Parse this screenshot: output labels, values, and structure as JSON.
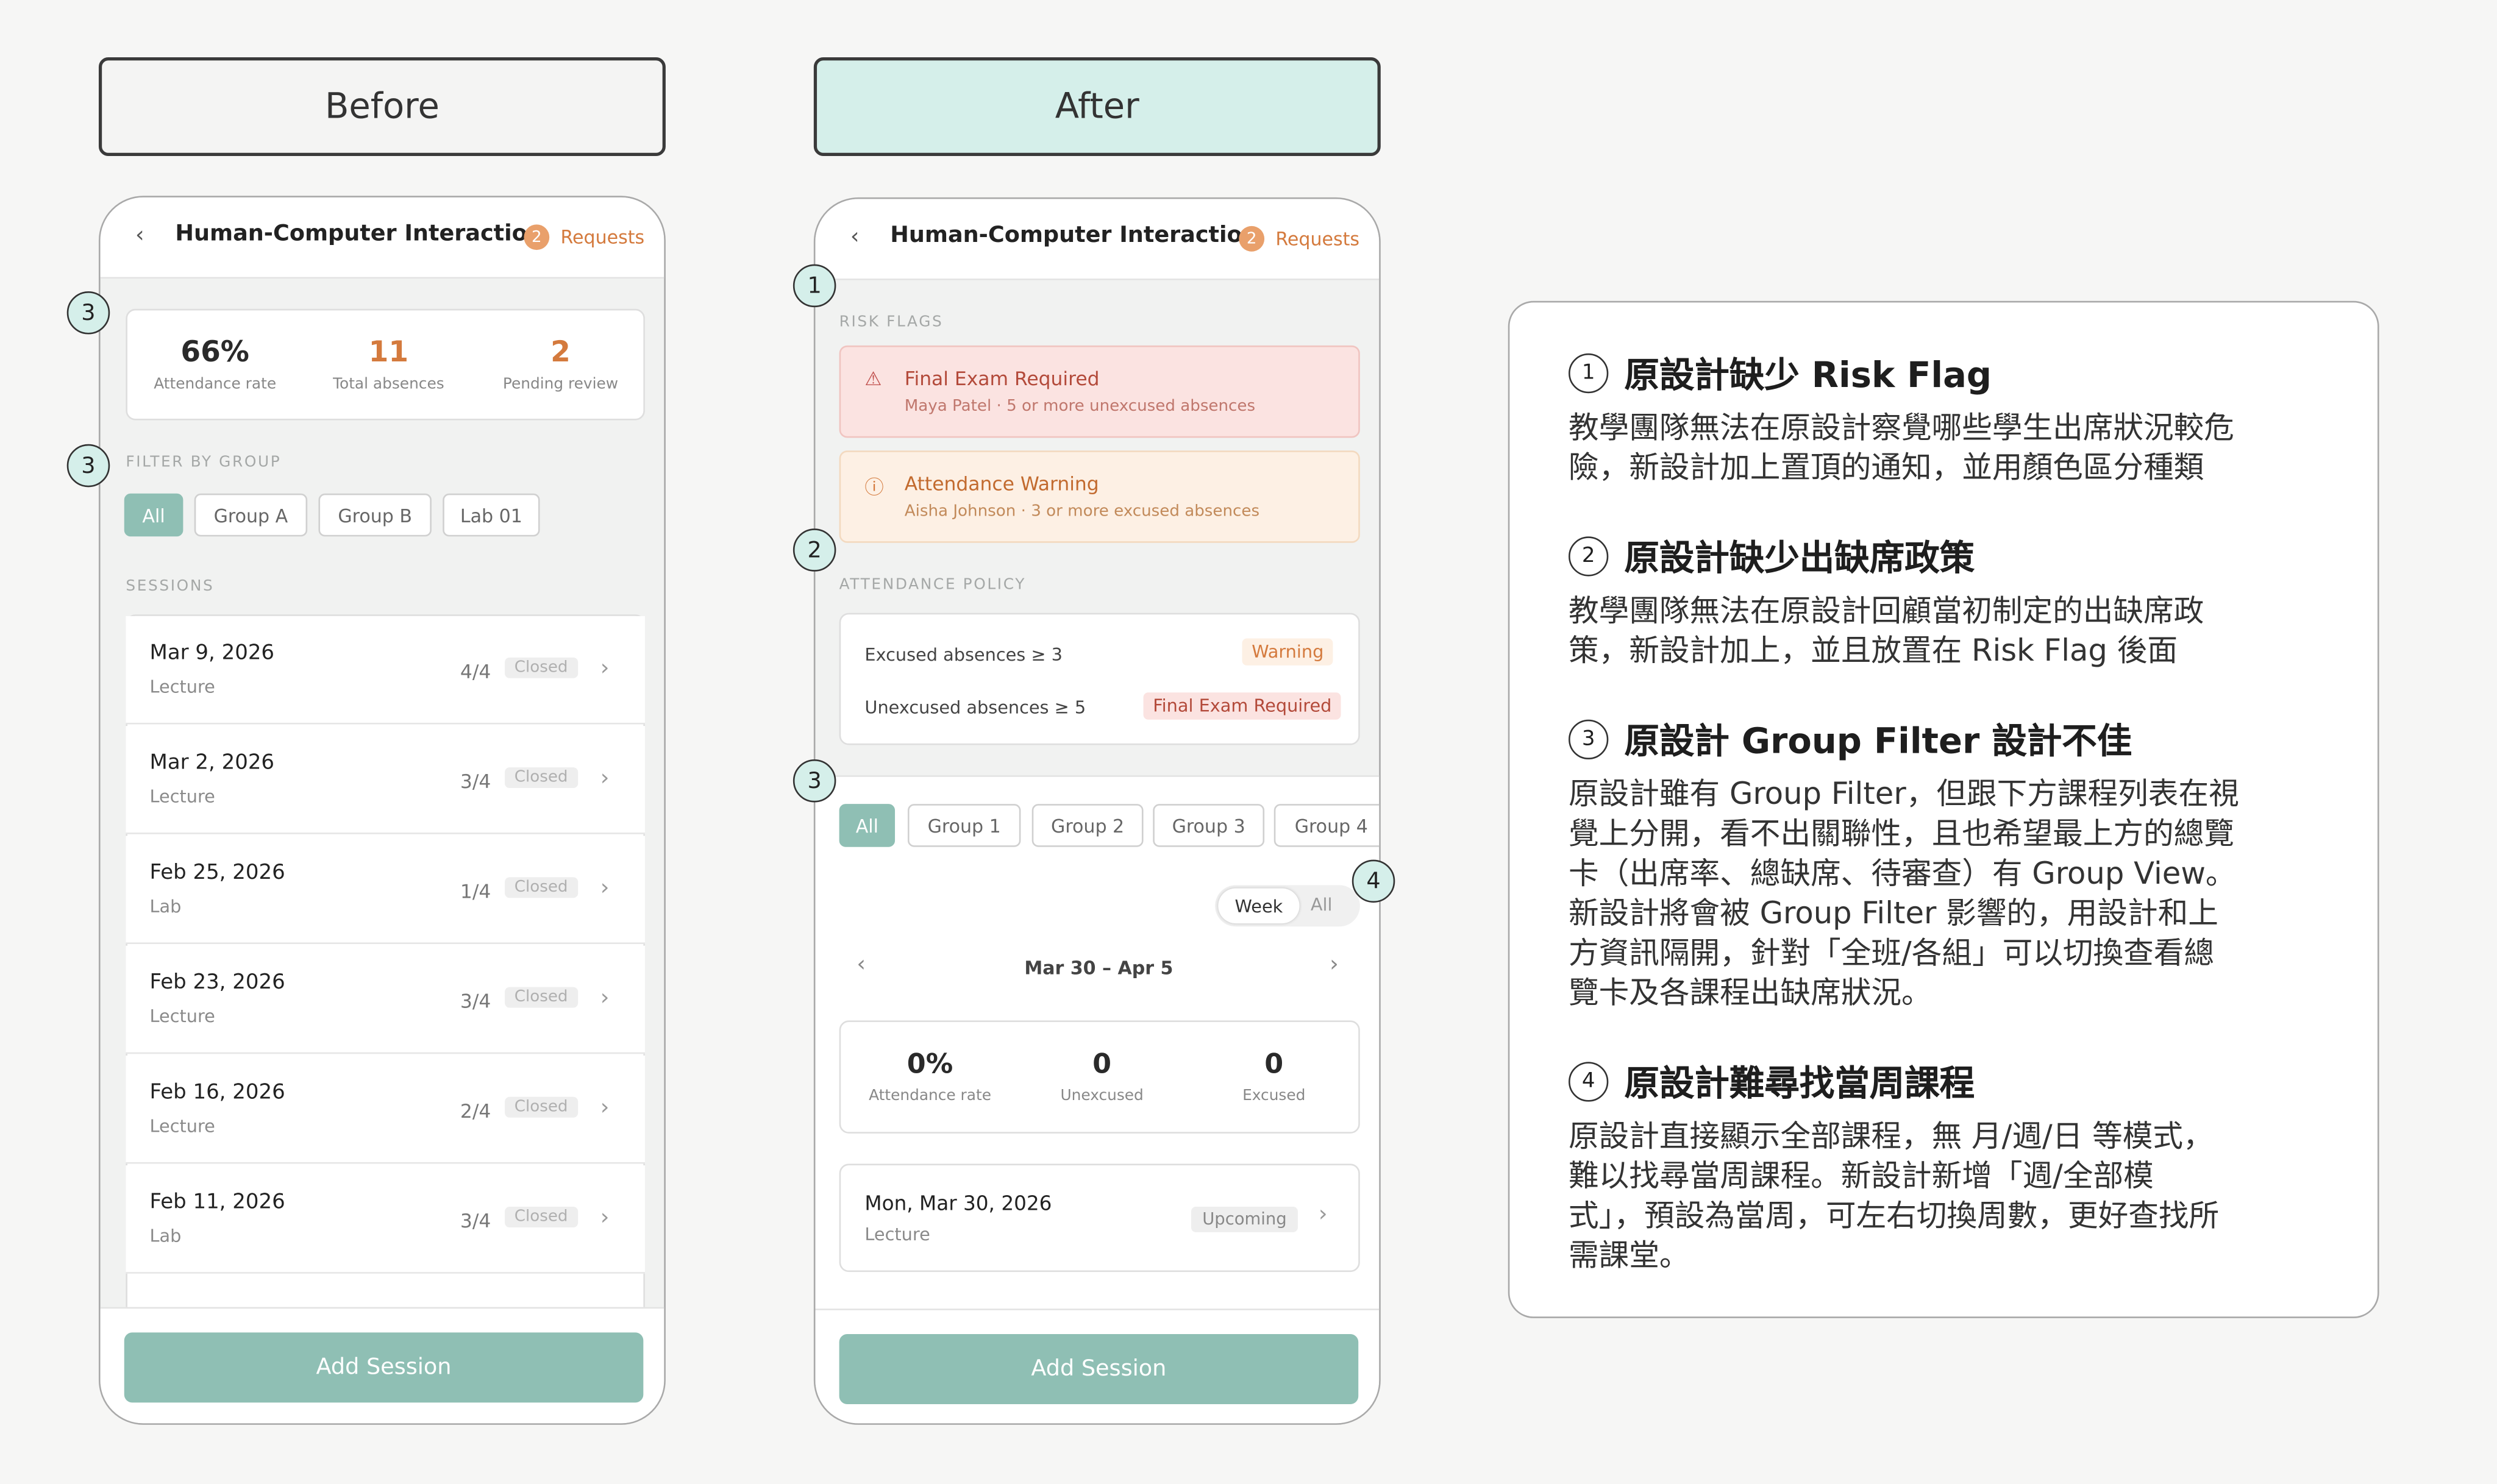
{
  "headers": {
    "before": "Before",
    "after": "After"
  },
  "app": {
    "title": "Human-Computer Interaction",
    "requests_count": "2",
    "requests_label": "Requests",
    "back_icon": "‹"
  },
  "before": {
    "stats": [
      {
        "value": "66%",
        "label": "Attendance rate"
      },
      {
        "value": "11",
        "label": "Total absences"
      },
      {
        "value": "2",
        "label": "Pending review"
      }
    ],
    "filter_label": "FILTER BY GROUP",
    "filters": [
      "All",
      "Group A",
      "Group B",
      "Lab 01"
    ],
    "sessions_label": "SESSIONS",
    "sessions": [
      {
        "date": "Mar 9, 2026",
        "type": "Lecture",
        "count": "4/4",
        "status": "Closed"
      },
      {
        "date": "Mar 2, 2026",
        "type": "Lecture",
        "count": "3/4",
        "status": "Closed"
      },
      {
        "date": "Feb 25, 2026",
        "type": "Lab",
        "count": "1/4",
        "status": "Closed"
      },
      {
        "date": "Feb 23, 2026",
        "type": "Lecture",
        "count": "3/4",
        "status": "Closed"
      },
      {
        "date": "Feb 16, 2026",
        "type": "Lecture",
        "count": "2/4",
        "status": "Closed"
      },
      {
        "date": "Feb 11, 2026",
        "type": "Lab",
        "count": "3/4",
        "status": "Closed"
      }
    ],
    "add_session": "Add Session"
  },
  "after": {
    "risk_label": "RISK FLAGS",
    "flags": [
      {
        "title": "Final Exam Required",
        "sub": "Maya Patel · 5 or more unexcused absences"
      },
      {
        "title": "Attendance Warning",
        "sub": "Aisha Johnson · 3 or more excused absences"
      }
    ],
    "policy_label": "ATTENDANCE POLICY",
    "policy": [
      {
        "rule": "Excused absences ≥ 3",
        "tag": "Warning"
      },
      {
        "rule": "Unexcused absences ≥ 5",
        "tag": "Final Exam Required"
      }
    ],
    "filters": [
      "All",
      "Group 1",
      "Group 2",
      "Group 3",
      "Group 4"
    ],
    "toggle": [
      "Week",
      "All"
    ],
    "week_range": "Mar 30 – Apr 5",
    "stats": [
      {
        "value": "0%",
        "label": "Attendance rate"
      },
      {
        "value": "0",
        "label": "Unexcused"
      },
      {
        "value": "0",
        "label": "Excused"
      }
    ],
    "session": {
      "date": "Mon, Mar 30, 2026",
      "type": "Lecture",
      "status": "Upcoming"
    },
    "add_session": "Add Session"
  },
  "markers": [
    "1",
    "2",
    "3",
    "4"
  ],
  "notes": [
    {
      "num": "1",
      "title": "原設計缺少 Risk Flag",
      "lines": [
        "教學團隊無法在原設計察覺哪些學生出席狀況較危",
        "險，新設計加上置頂的通知，並用顏色區分種類"
      ]
    },
    {
      "num": "2",
      "title": "原設計缺少出缺席政策",
      "lines": [
        "教學團隊無法在原設計回顧當初制定的出缺席政",
        "策，新設計加上，並且放置在 Risk Flag 後面"
      ]
    },
    {
      "num": "3",
      "title": "原設計 Group Filter 設計不佳",
      "lines": [
        "原設計雖有 Group Filter，但跟下方課程列表在視",
        "覺上分開，看不出關聯性，且也希望最上方的總覽",
        "卡（出席率、總缺席、待審查）有 Group View。",
        "新設計將會被 Group Filter 影響的，用設計和上",
        "方資訊隔開，針對「全班/各組」可以切換查看總",
        "覽卡及各課程出缺席狀況。"
      ]
    },
    {
      "num": "4",
      "title": "原設計難尋找當周課程",
      "lines": [
        "原設計直接顯示全部課程，無 月/週/日 等模式，",
        "難以找尋當周課程。新設計新增「週/全部模",
        "式」，預設為當周，可左右切換周數，更好查找所",
        "需課堂。"
      ]
    }
  ],
  "colors": {
    "accent": "#8fbfb4",
    "warn_orange": "#d47a3d",
    "danger_red": "#c0504d",
    "marker_fill": "#d5efea"
  }
}
